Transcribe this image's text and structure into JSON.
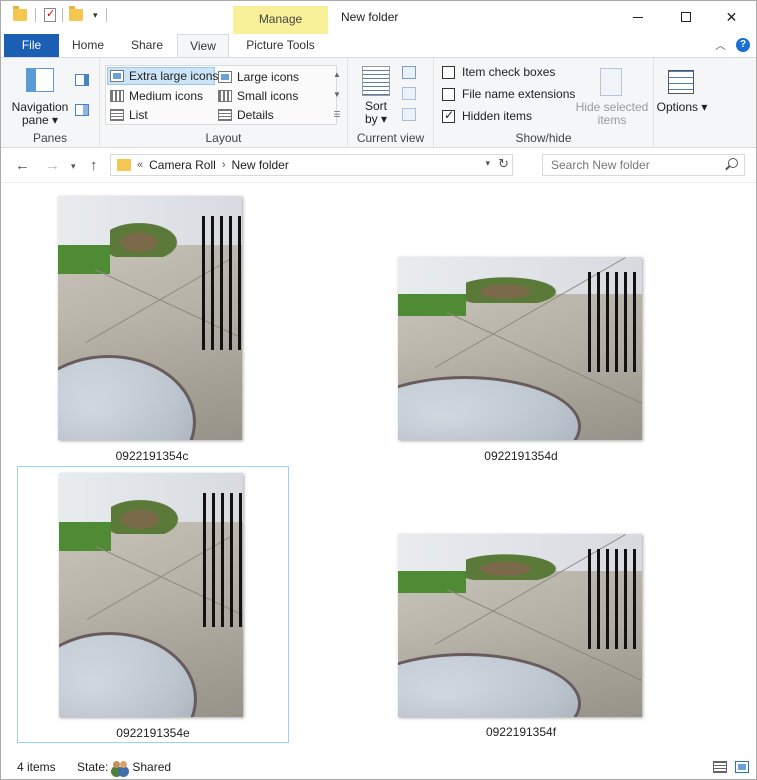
{
  "titlebar": {
    "manage_label": "Manage",
    "window_title": "New folder",
    "minimize_glyph": "",
    "close_glyph": "✕"
  },
  "tabs": {
    "file": "File",
    "home": "Home",
    "share": "Share",
    "view": "View",
    "picture_tools": "Picture Tools"
  },
  "ribbon": {
    "panes": {
      "label": "Panes",
      "navigation_pane": "Navigation pane ▾"
    },
    "layout": {
      "label": "Layout",
      "items": {
        "extra_large": "Extra large icons",
        "large": "Large icons",
        "medium": "Medium icons",
        "small": "Small icons",
        "list": "List",
        "details": "Details"
      },
      "selected": "Extra large icons"
    },
    "current_view": {
      "label": "Current view",
      "sort_by": "Sort by ▾"
    },
    "show_hide": {
      "label": "Show/hide",
      "item_check_boxes": {
        "label": "Item check boxes",
        "checked": false
      },
      "file_name_extensions": {
        "label": "File name extensions",
        "checked": false
      },
      "hidden_items": {
        "label": "Hidden items",
        "checked": true
      },
      "hide_selected_items": "Hide selected items"
    },
    "options": {
      "label": "Options ▾"
    }
  },
  "address": {
    "prefix": "«",
    "crumbs": [
      "Camera Roll",
      "New folder"
    ],
    "separator": "›",
    "search_placeholder": "Search New folder"
  },
  "files": [
    {
      "name": "0922191354c",
      "orientation": "portrait",
      "selected": false
    },
    {
      "name": "0922191354d",
      "orientation": "landscape",
      "selected": false
    },
    {
      "name": "0922191354e",
      "orientation": "portrait",
      "selected": true
    },
    {
      "name": "0922191354f",
      "orientation": "landscape",
      "selected": false
    }
  ],
  "status": {
    "item_count": "4 items",
    "state_label": "State:",
    "state_value": "Shared"
  },
  "colors": {
    "file_tab": "#1a5fb4",
    "manage_tab": "#f8f19a",
    "selection": "#cce4f7",
    "selection_border": "#99d1ff",
    "folder": "#f5c750"
  }
}
